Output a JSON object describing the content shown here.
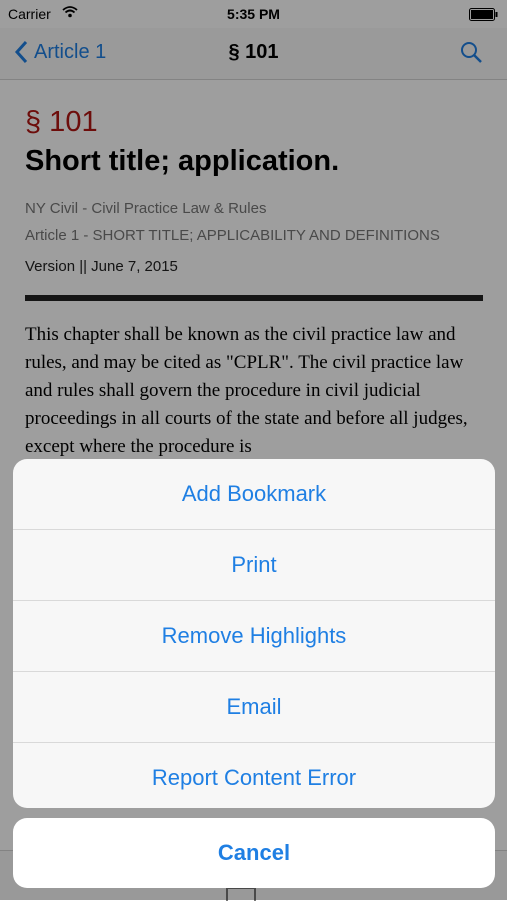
{
  "status_bar": {
    "carrier": "Carrier",
    "time": "5:35 PM"
  },
  "nav": {
    "back_label": "Article 1",
    "title": "§ 101"
  },
  "article": {
    "section_number": "§ 101",
    "title": "Short title; application.",
    "code": "NY Civil - Civil Practice Law & Rules",
    "article_line": "Article 1 - SHORT TITLE; APPLICABILITY AND DEFINITIONS",
    "version": "Version || June 7, 2015",
    "body": "This chapter shall be known as the civil practice law and rules, and may be cited as \"CPLR\". The civil practice law and rules shall govern the procedure in civil judicial proceedings in all courts of the state and before all judges, except where the procedure is"
  },
  "action_sheet": {
    "items": [
      {
        "label": "Add Bookmark"
      },
      {
        "label": "Print"
      },
      {
        "label": "Remove Highlights"
      },
      {
        "label": "Email"
      },
      {
        "label": "Report Content Error"
      }
    ],
    "cancel_label": "Cancel"
  },
  "colors": {
    "accent": "#1f7fe3",
    "section_red": "#b01512"
  }
}
